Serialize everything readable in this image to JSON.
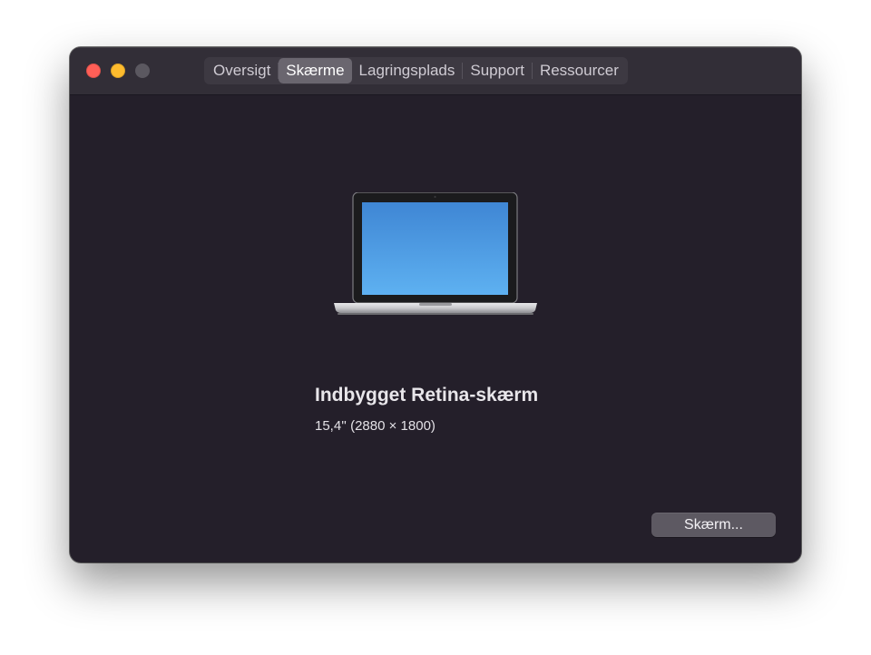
{
  "window": {
    "controls": [
      "close",
      "minimize",
      "zoom"
    ]
  },
  "tabs": [
    {
      "label": "Oversigt",
      "selected": false
    },
    {
      "label": "Skærme",
      "selected": true
    },
    {
      "label": "Lagringsplads",
      "selected": false
    },
    {
      "label": "Support",
      "selected": false
    },
    {
      "label": "Ressourcer",
      "selected": false
    }
  ],
  "display": {
    "icon": "laptop-icon",
    "name": "Indbygget Retina-skærm",
    "details": "15,4'' (2880 × 1800)"
  },
  "actions": {
    "display_button_label": "Skærm..."
  },
  "colors": {
    "window_bg": "#241f2a",
    "titlebar_bg": "#322e37",
    "close": "#ff5f57",
    "minimize": "#febc2e",
    "zoom_inactive": "#5b5860",
    "selected_tab": "#6a666f",
    "screen_top": "#3f86d4",
    "screen_bottom": "#5eb1f1"
  }
}
